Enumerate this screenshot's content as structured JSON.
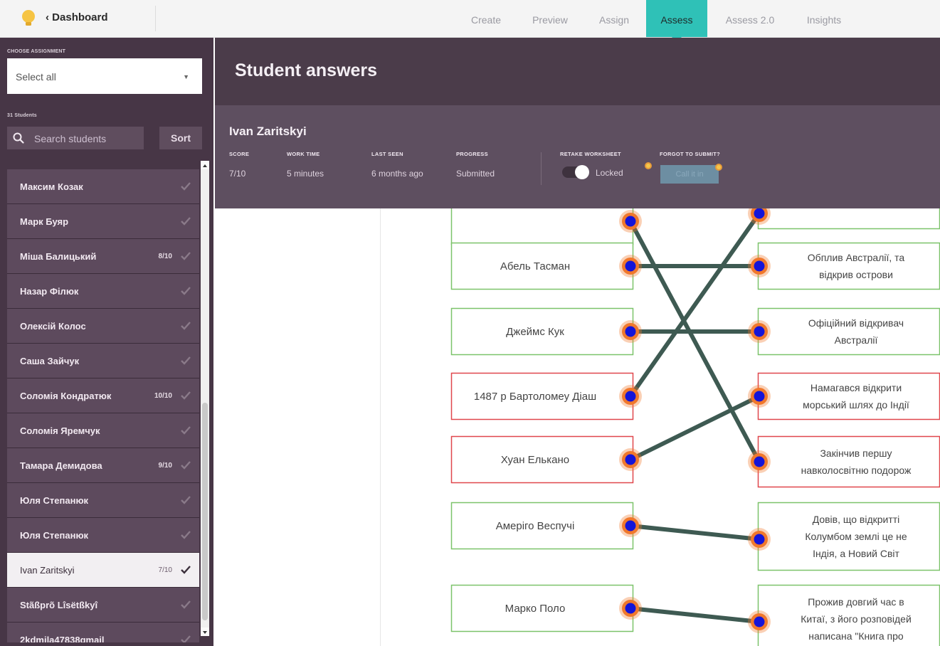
{
  "topbar": {
    "back_label": "Dashboard",
    "tabs": [
      {
        "label": "Create"
      },
      {
        "label": "Preview"
      },
      {
        "label": "Assign"
      },
      {
        "label": "Assess"
      },
      {
        "label": "Assess 2.0"
      },
      {
        "label": "Insights"
      }
    ],
    "active_tab": "Assess"
  },
  "sidebar": {
    "choose_assignment_label": "CHOOSE ASSIGNMENT",
    "select_value": "Select all",
    "students_count_label": "31 Students",
    "search_placeholder": "Search students",
    "sort_label": "Sort",
    "students": [
      {
        "name": "Максим Козак",
        "score": ""
      },
      {
        "name": "Марк Буяр",
        "score": ""
      },
      {
        "name": "Міша Балицький",
        "score": "8/10"
      },
      {
        "name": "Назар Філюк",
        "score": ""
      },
      {
        "name": "Олексій Колос",
        "score": ""
      },
      {
        "name": "Саша Зайчук",
        "score": ""
      },
      {
        "name": "Соломія Кондратюк",
        "score": "10/10"
      },
      {
        "name": "Соломія Яремчук",
        "score": ""
      },
      {
        "name": "Тамара Демидова",
        "score": "9/10"
      },
      {
        "name": "Юля Степанюк",
        "score": ""
      },
      {
        "name": "Юля Степанюк",
        "score": ""
      },
      {
        "name": "Ivan Zaritskyi",
        "score": "7/10",
        "active": true
      },
      {
        "name": "Stãßprõ Lîsëtßkyî",
        "score": ""
      },
      {
        "name": "2kdmila47838gmail",
        "score": ""
      }
    ]
  },
  "main": {
    "title": "Student answers",
    "student": {
      "name": "Ivan Zaritskyi",
      "score_label": "SCORE",
      "score_value": "7/10",
      "work_time_label": "WORK TIME",
      "work_time_value": "5 minutes",
      "last_seen_label": "LAST SEEN",
      "last_seen_value": "6 months ago",
      "progress_label": "PROGRESS",
      "progress_value": "Submitted",
      "retake_label": "RETAKE WORKSHEET",
      "retake_state": "Locked",
      "forgot_label": "FORGOT TO SUBMIT?",
      "call_in_label": "Call it in"
    }
  },
  "matching": {
    "colors": {
      "correct": "#7cc36a",
      "wrong": "#e0474c",
      "line": "#3e5a52",
      "ring": "#f0782c",
      "dot": "#1414d8"
    },
    "left_items": [
      {
        "text": "",
        "status": "correct"
      },
      {
        "text": "Абель Тасман",
        "status": "correct"
      },
      {
        "text": "Джеймс Кук",
        "status": "correct"
      },
      {
        "text": "1487 р Бартоломеу Діаш",
        "status": "wrong"
      },
      {
        "text": "Хуан Елькано",
        "status": "wrong"
      },
      {
        "text": "Амеріго Веспучі",
        "status": "correct"
      },
      {
        "text": "Марко Поло",
        "status": "correct"
      }
    ],
    "right_items": [
      {
        "lines": [
          ""
        ],
        "status": "correct"
      },
      {
        "lines": [
          "Обплив Австралії, та",
          "відкрив острови"
        ],
        "status": "correct"
      },
      {
        "lines": [
          "Офіційний відкривач",
          "Австралії"
        ],
        "status": "correct"
      },
      {
        "lines": [
          "Намагався відкрити",
          "морський шлях до Індії"
        ],
        "status": "wrong"
      },
      {
        "lines": [
          "Закінчив першу",
          "навколосвітню подорож"
        ],
        "status": "wrong"
      },
      {
        "lines": [
          "Довів, що відкритті",
          "Колумбом землі це не",
          "Індія, а Новий Світ"
        ],
        "status": "correct"
      },
      {
        "lines": [
          "Прожив довгий час в",
          "Китаї, з його розповідей",
          "написана \"Книга про"
        ],
        "status": "correct"
      }
    ],
    "connections": [
      [
        1,
        1
      ],
      [
        2,
        2
      ],
      [
        3,
        0
      ],
      [
        4,
        3
      ],
      [
        5,
        5
      ],
      [
        6,
        6
      ],
      [
        0,
        4
      ]
    ]
  }
}
